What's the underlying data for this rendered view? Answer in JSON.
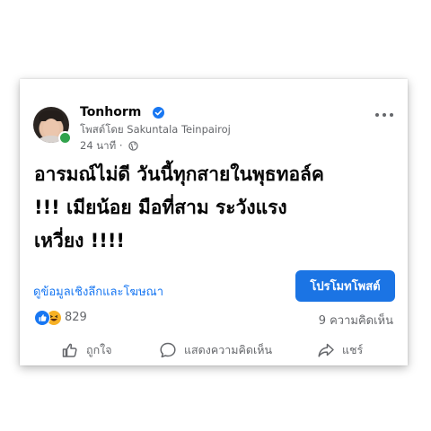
{
  "header": {
    "name": "Tonhorm",
    "byline": "โพสต์โดย Sakuntala Teinpairoj",
    "time": "24 นาที ·"
  },
  "post": {
    "text": "อารมณ์ไม่ดี วันนี้ทุกสายในพุธทอล์ค\n!!! เมียน้อย มือที่สาม ระวังแรง\nเหวี่ยง !!!!"
  },
  "insights_link": "ดูข้อมูลเชิงลึกและโฆษณา",
  "promote_button": "โปรโมทโพสต์",
  "stats": {
    "reactions": "829",
    "comments": "9 ความคิดเห็น"
  },
  "actions": {
    "like": "ถูกใจ",
    "comment": "แสดงความคิดเห็น",
    "share": "แชร์"
  },
  "colors": {
    "accent": "#1877f2",
    "online": "#31a24c",
    "secondary_text": "#65676b"
  }
}
